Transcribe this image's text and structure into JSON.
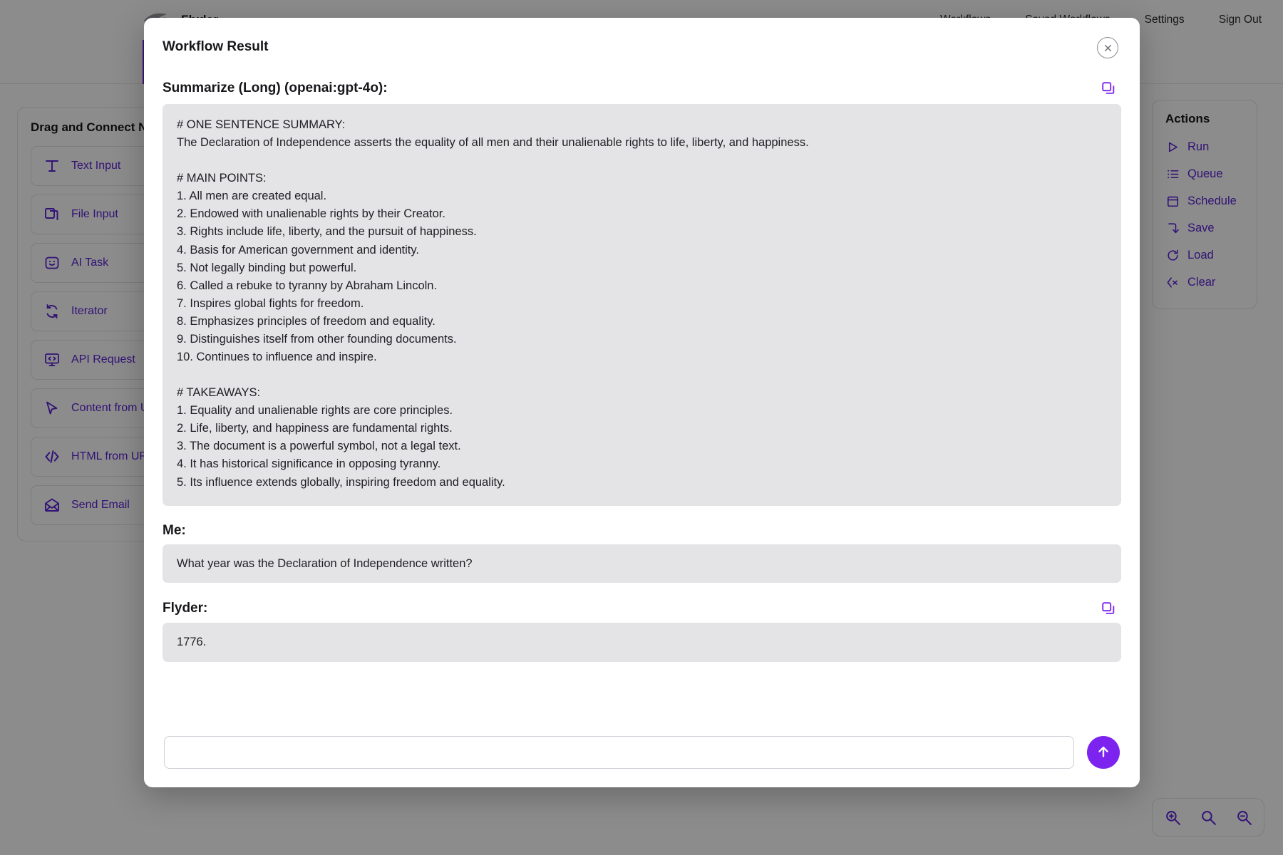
{
  "nav": {
    "brand": "Flyder",
    "links": [
      {
        "label": "Workflows"
      },
      {
        "label": "Saved Workflows"
      },
      {
        "label": "Settings"
      },
      {
        "label": "Sign Out"
      }
    ]
  },
  "palette": {
    "title": "Drag and Connect Nodes",
    "items": [
      {
        "label": "Text Input",
        "icon": "text-input-icon"
      },
      {
        "label": "File Input",
        "icon": "file-input-icon"
      },
      {
        "label": "AI Task",
        "icon": "ai-task-icon"
      },
      {
        "label": "Iterator",
        "icon": "iterator-icon"
      },
      {
        "label": "API Request",
        "icon": "api-request-icon"
      },
      {
        "label": "Content from URL",
        "icon": "content-from-url-icon"
      },
      {
        "label": "HTML from URL",
        "icon": "html-from-url-icon"
      },
      {
        "label": "Send Email",
        "icon": "send-email-icon"
      }
    ]
  },
  "actions": {
    "title": "Actions",
    "items": [
      {
        "label": "Run",
        "icon": "play-icon"
      },
      {
        "label": "Queue",
        "icon": "list-icon"
      },
      {
        "label": "Schedule",
        "icon": "calendar-icon"
      },
      {
        "label": "Save",
        "icon": "arrow-down-right-icon"
      },
      {
        "label": "Load",
        "icon": "refresh-icon"
      },
      {
        "label": "Clear",
        "icon": "clear-x-icon"
      }
    ]
  },
  "zoom_controls": [
    {
      "name": "zoom-in-icon",
      "label": "Zoom In"
    },
    {
      "name": "zoom-reset-icon",
      "label": "Reset Zoom"
    },
    {
      "name": "zoom-out-icon",
      "label": "Zoom Out"
    }
  ],
  "modal": {
    "title": "Workflow Result",
    "close_label": "Close",
    "result": {
      "heading": "Summarize (Long) (openai:gpt-4o):",
      "copy_label": "Copy",
      "text": "# ONE SENTENCE SUMMARY:\nThe Declaration of Independence asserts the equality of all men and their unalienable rights to life, liberty, and happiness.\n\n# MAIN POINTS:\n1. All men are created equal.\n2. Endowed with unalienable rights by their Creator.\n3. Rights include life, liberty, and the pursuit of happiness.\n4. Basis for American government and identity.\n5. Not legally binding but powerful.\n6. Called a rebuke to tyranny by Abraham Lincoln.\n7. Inspires global fights for freedom.\n8. Emphasizes principles of freedom and equality.\n9. Distinguishes itself from other founding documents.\n10. Continues to influence and inspire.\n\n# TAKEAWAYS:\n1. Equality and unalienable rights are core principles.\n2. Life, liberty, and happiness are fundamental rights.\n3. The document is a powerful symbol, not a legal text.\n4. It has historical significance in opposing tyranny.\n5. Its influence extends globally, inspiring freedom and equality."
    },
    "chat": [
      {
        "speaker": "Me:",
        "message": "What year was the Declaration of Independence written?",
        "has_copy": false
      },
      {
        "speaker": "Flyder:",
        "message": "1776.",
        "has_copy": true,
        "copy_label": "Copy"
      }
    ],
    "composer": {
      "value": "",
      "placeholder": "",
      "send_label": "Send"
    }
  },
  "colors": {
    "accent_purple": "#5b21d6",
    "bright_purple": "#7c23f0",
    "result_bg": "#e4e4e6",
    "text_dark": "#17171b"
  }
}
